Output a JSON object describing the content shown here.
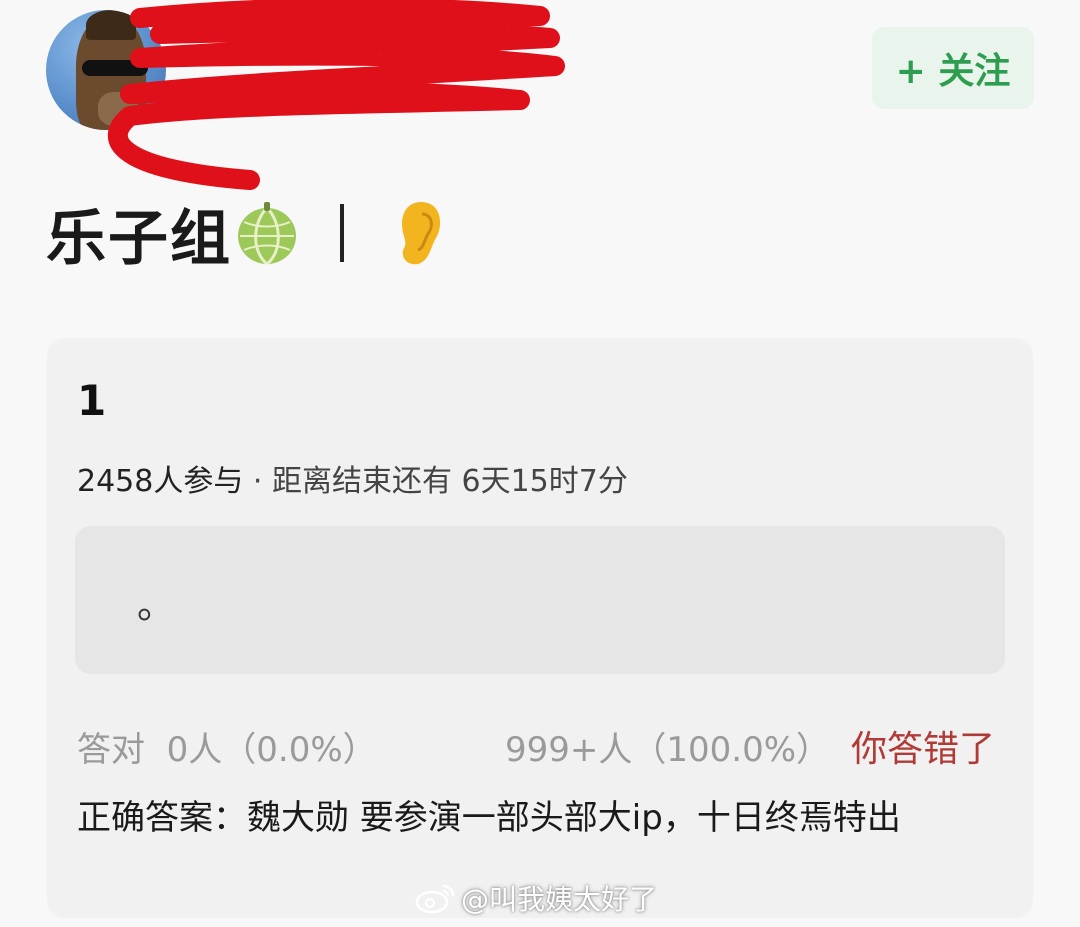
{
  "header": {
    "follow_label": "+ 关注"
  },
  "group": {
    "name": "乐子组",
    "icons": [
      "melon-emoji-icon",
      "ear-emoji-icon"
    ]
  },
  "quiz": {
    "title": "1",
    "participants": "2458人参与",
    "separator": " · ",
    "time_left": "距离结束还有 6天15时7分",
    "option_text": "。",
    "correct_label": "答对",
    "correct_stats": "0人（0.0%）",
    "wrong_stats": "999+人（100.0%）",
    "result": "你答错了",
    "answer": "正确答案：魏大勋 要参演一部头部大ip，十日终焉特出"
  },
  "watermark": {
    "text": "@叫我姨太好了",
    "icon": "weibo-icon"
  },
  "colors": {
    "follow_green": "#2e9d4f",
    "wrong_red": "#b03a36",
    "scribble_red": "#e0101a"
  }
}
